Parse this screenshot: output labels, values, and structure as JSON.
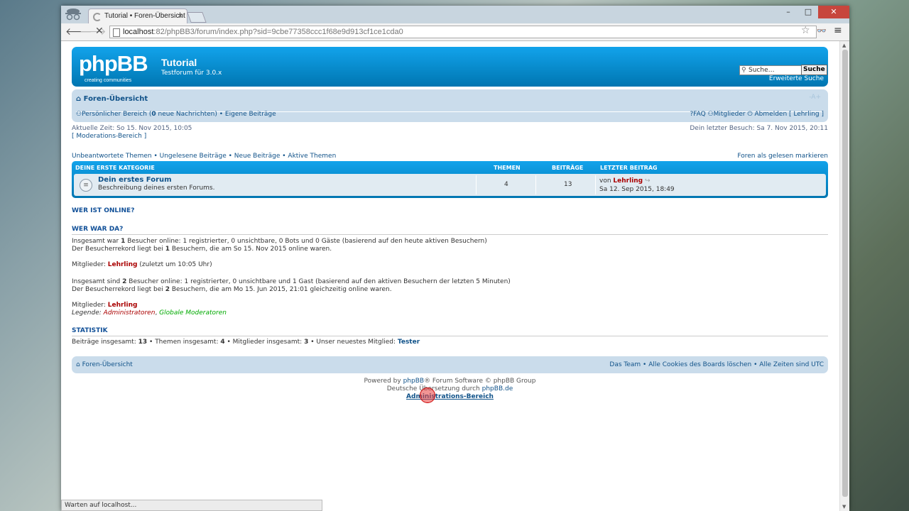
{
  "browser": {
    "tab_title": "Tutorial • Foren-Übersicht",
    "tab_close": "×",
    "url_host": "localhost",
    "url_rest": ":82/phpBB3/forum/index.php?sid=9cbe77358ccc1f68e9d913cf1ce1cda0",
    "status": "Warten auf localhost...",
    "window_buttons": [
      "–",
      "□",
      "✕"
    ]
  },
  "header": {
    "logo": "phpBB",
    "logo_tagline": "creating   communities",
    "site_title": "Tutorial",
    "site_desc": "Testforum für 3.0.x",
    "search_placeholder": "Suche…",
    "search_button": "Suche",
    "advanced_search": "Erweiterte Suche"
  },
  "navbar": {
    "home": "Foren-Übersicht",
    "resize": "-A+",
    "ucp": "Persönlicher Bereich",
    "messages_count": "0",
    "messages_label": "neue Nachrichten",
    "own_posts": "Eigene Beiträge",
    "faq": "FAQ",
    "members": "Mitglieder",
    "logout": "Abmelden",
    "logout_user": "[ Lehrling ]"
  },
  "times": {
    "current": "Aktuelle Zeit: So 15. Nov 2015, 10:05",
    "mcp": "[ Moderations-Bereich ]",
    "last_visit": "Dein letzter Besuch: Sa 7. Nov 2015, 20:11"
  },
  "quicklinks": {
    "items": [
      "Unbeantwortete Themen",
      "Ungelesene Beiträge",
      "Neue Beiträge",
      "Aktive Themen"
    ],
    "mark_read": "Foren als gelesen markieren"
  },
  "category": {
    "title": "DEINE ERSTE KATEGORIE",
    "col_topics": "THEMEN",
    "col_posts": "BEITRÄGE",
    "col_last": "LETZTER BEITRAG",
    "forum": {
      "name": "Dein erstes Forum",
      "desc": "Beschreibung deines ersten Forums.",
      "topics": "4",
      "posts": "13",
      "last_by_prefix": "von",
      "last_by": "Lehrling",
      "last_date": "Sa 12. Sep 2015, 18:49"
    }
  },
  "online": {
    "title": "WER IST ONLINE?",
    "was_title": "WER WAR DA?",
    "today_1": "Insgesamt war",
    "today_n": "1",
    "today_2": "Besucher online: 1 registrierter, 0 unsichtbare, 0 Bots und 0 Gäste (basierend auf den heute aktiven Besuchern)",
    "today_record_1": "Der Besucherrekord liegt bei",
    "today_record_n": "1",
    "today_record_2": "Besuchern, die am So 15. Nov 2015 online waren.",
    "today_members_label": "Mitglieder:",
    "today_members_user": "Lehrling",
    "today_members_time": "(zuletzt um 10:05 Uhr)",
    "now_1": "Insgesamt sind",
    "now_n": "2",
    "now_2": "Besucher online: 1 registrierter, 0 unsichtbare und 1 Gast (basierend auf den aktiven Besuchern der letzten 5 Minuten)",
    "now_record_1": "Der Besucherrekord liegt bei",
    "now_record_n": "2",
    "now_record_2": "Besuchern, die am Mo 15. Jun 2015, 21:01 gleichzeitig online waren.",
    "now_members_label": "Mitglieder:",
    "now_members_user": "Lehrling",
    "legend_label": "Legende:",
    "legend_admin": "Administratoren",
    "legend_mod": "Globale Moderatoren"
  },
  "stats": {
    "title": "STATISTIK",
    "posts_label": "Beiträge insgesamt:",
    "posts": "13",
    "topics_label": "Themen insgesamt:",
    "topics": "4",
    "members_label": "Mitglieder insgesamt:",
    "members": "3",
    "newest_label": "Unser neuestes Mitglied:",
    "newest": "Tester"
  },
  "footer": {
    "home": "Foren-Übersicht",
    "team": "Das Team",
    "cookies": "Alle Cookies des Boards löschen",
    "timezone": "Alle Zeiten sind UTC",
    "powered_1": "Powered by",
    "powered_link": "phpBB",
    "powered_2": "® Forum Software © phpBB Group",
    "translation_1": "Deutsche Übersetzung durch",
    "translation_link": "phpBB.de",
    "acp": "Administrations-Bereich"
  }
}
